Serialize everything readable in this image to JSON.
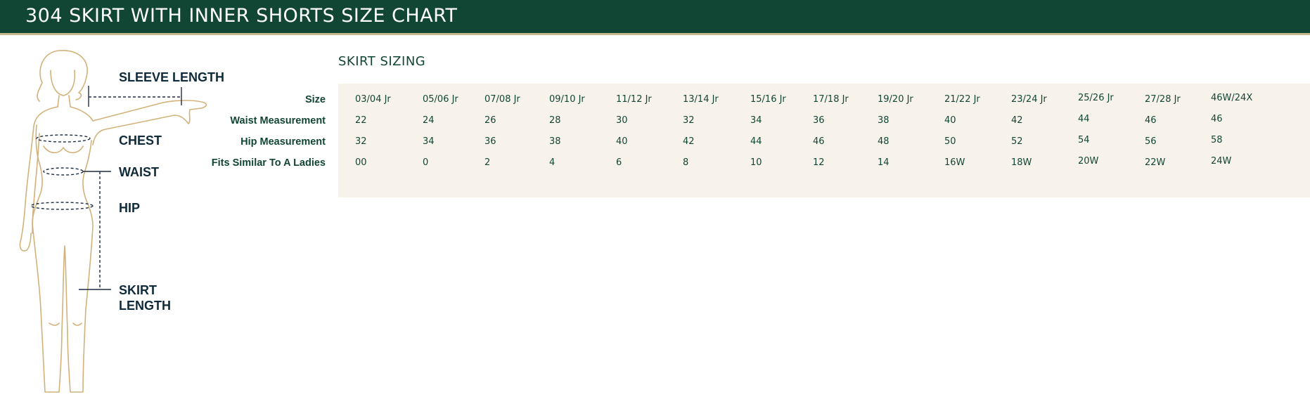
{
  "header": {
    "title": "304 SKIRT WITH INNER SHORTS SIZE CHART"
  },
  "figure": {
    "labels": {
      "sleeve_length": "SLEEVE LENGTH",
      "chest": "CHEST",
      "waist": "WAIST",
      "hip": "HIP",
      "skirt_line1": "SKIRT",
      "skirt_line2": "LENGTH"
    }
  },
  "section": {
    "title": "SKIRT SIZING"
  },
  "table": {
    "row_labels": [
      "Size",
      "Waist Measurement",
      "Hip Measurement",
      "Fits Similar To A Ladies"
    ],
    "sizes": [
      "03/04 Jr",
      "05/06  Jr",
      "07/08  Jr",
      "09/10 Jr",
      "11/12  Jr",
      "13/14 Jr",
      "15/16 Jr",
      "17/18 Jr",
      "19/20 Jr",
      "21/22 Jr",
      "23/24 Jr",
      "25/26 Jr",
      "27/28 Jr",
      "46W/24X"
    ],
    "waist": [
      "22",
      "24",
      "26",
      "28",
      "30",
      "32",
      "34",
      "36",
      "38",
      "40",
      "42",
      "44",
      "46",
      "46"
    ],
    "hip": [
      "32",
      "34",
      "36",
      "38",
      "40",
      "42",
      "44",
      "46",
      "48",
      "50",
      "52",
      "54",
      "56",
      "58"
    ],
    "fits_similar": [
      "00",
      "0",
      "2",
      "4",
      "6",
      "8",
      "10",
      "12",
      "14",
      "16W",
      "18W",
      "20W",
      "22W",
      "24W"
    ]
  },
  "colors": {
    "header_bg": "#124634",
    "accent_line": "#c9b98a",
    "table_bg": "#f7f2ea",
    "text_green": "#124634",
    "label_navy": "#0f2a3a",
    "figure_line": "#d2b27a"
  }
}
